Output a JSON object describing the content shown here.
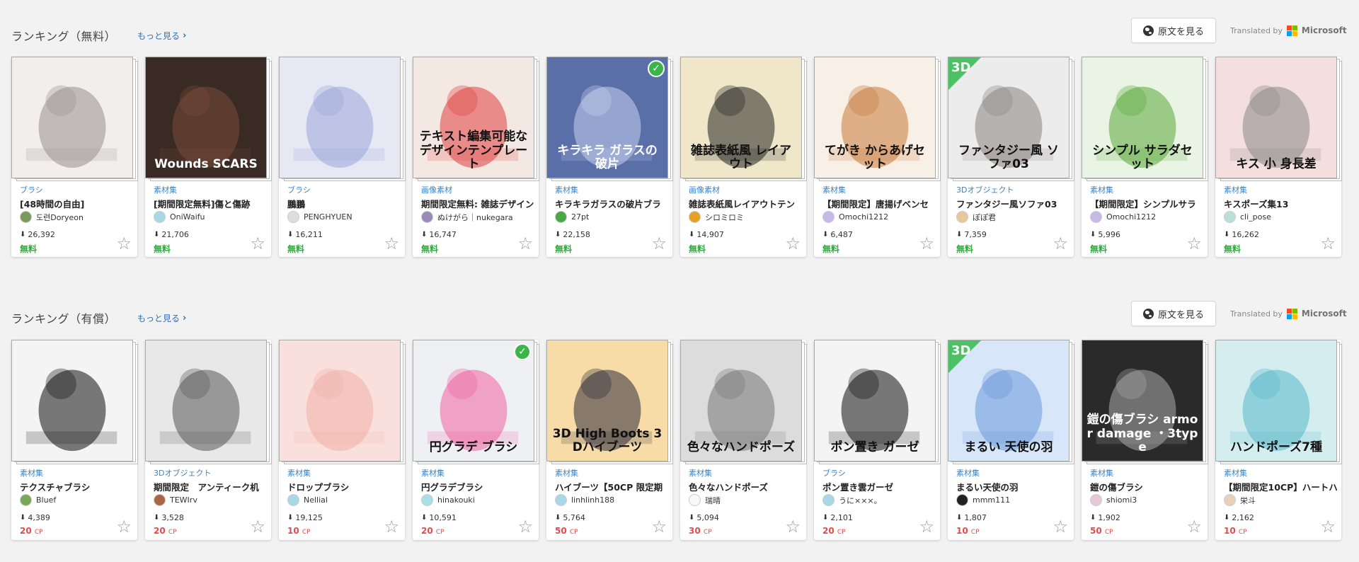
{
  "translate": {
    "button_label": "原文を見る",
    "translated_by": "Translated by",
    "provider": "Microsoft",
    "logo_colors": [
      "#f25022",
      "#7fba00",
      "#00a4ef",
      "#ffb900"
    ]
  },
  "sections": [
    {
      "title": "ランキング（無料）",
      "more": "もっと見る",
      "items": [
        {
          "category": "ブラシ",
          "title": "[48時間の自由]",
          "author": "도련Doryeon",
          "downloads": "26,392",
          "price": "無料",
          "checked": false,
          "bg": "#f2eeee",
          "fg": "#9a8f8f",
          "avatar": "#7a9a5a"
        },
        {
          "category": "素材集",
          "title": "[期間限定無料]傷と傷跡",
          "author": "OniWaifu",
          "downloads": "21,706",
          "price": "無料",
          "checked": false,
          "bg": "#3a2a24",
          "fg": "#7a4a3a",
          "avatar": "#a8d8e6",
          "thumb_text": "Wounds SCARS"
        },
        {
          "category": "ブラシ",
          "title": "鵬鵬",
          "author": "PENGHYUEN",
          "downloads": "16,211",
          "price": "無料",
          "checked": false,
          "bg": "#e6e8f4",
          "fg": "#9aa6d8",
          "avatar": "#ddd"
        },
        {
          "category": "画像素材",
          "title": "期間限定無料: 雑誌デザイン",
          "author": "ぬけがら｜nukegara",
          "downloads": "16,747",
          "price": "無料",
          "checked": false,
          "bg": "#f3e8e2",
          "fg": "#e04040",
          "avatar": "#9a8ab8",
          "thumb_text": "テキスト編集可能なデザインテンプレート"
        },
        {
          "category": "素材集",
          "title": "キラキラガラスの破片ブラ",
          "author": "27pt",
          "downloads": "22,158",
          "price": "無料",
          "checked": true,
          "bg": "#5a6ea8",
          "fg": "#c8d4f0",
          "avatar": "#48a848",
          "thumb_text": "キラキラ ガラスの破片"
        },
        {
          "category": "画像素材",
          "title": "雑誌表紙風レイアウトテン",
          "author": "シロミロミ",
          "downloads": "14,907",
          "price": "無料",
          "checked": false,
          "bg": "#f0e6c8",
          "fg": "#222",
          "avatar": "#e8a020",
          "thumb_text": "雑誌表紙風 レイアウト"
        },
        {
          "category": "素材集",
          "title": "【期間限定】唐揚げベンセ",
          "author": "Omochi1212",
          "downloads": "6,487",
          "price": "無料",
          "checked": false,
          "bg": "#f8f0e6",
          "fg": "#c87838",
          "avatar": "#c8b8e8",
          "thumb_text": "てがき からあげセット"
        },
        {
          "category": "3Dオブジェクト",
          "title": "ファンタジー風ソファ03",
          "author": "ぽぽ君",
          "downloads": "7,359",
          "price": "無料",
          "checked": false,
          "bg": "#ececec",
          "fg": "#8a8480",
          "avatar": "#e8c898",
          "thumb_text": "ファンタジー風 ソファ03",
          "badge": "3D"
        },
        {
          "category": "素材集",
          "title": "【期間限定】シンプルサラ",
          "author": "Omochi1212",
          "downloads": "5,996",
          "price": "無料",
          "checked": false,
          "bg": "#eaf4e4",
          "fg": "#58a838",
          "avatar": "#c8b8e8",
          "thumb_text": "シンプル サラダセット"
        },
        {
          "category": "素材集",
          "title": "キスポーズ集13",
          "author": "cli_pose",
          "downloads": "16,262",
          "price": "無料",
          "checked": false,
          "bg": "#f4dede",
          "fg": "#888",
          "avatar": "#b8e0d8",
          "thumb_text": "キス 小 身長差"
        }
      ]
    },
    {
      "title": "ランキング（有償）",
      "more": "もっと見る",
      "items": [
        {
          "category": "素材集",
          "title": "テクスチャブラシ",
          "author": "Bluef",
          "downloads": "4,389",
          "price": "20",
          "checked": false,
          "bg": "#f4f4f4",
          "fg": "#111",
          "avatar": "#78a858"
        },
        {
          "category": "3Dオブジェクト",
          "title": "期間限定　アンティーク机",
          "author": "TEWIrv",
          "downloads": "3,528",
          "price": "20",
          "checked": false,
          "bg": "#e8e8e8",
          "fg": "#555",
          "avatar": "#a86848"
        },
        {
          "category": "素材集",
          "title": "ドロップブラシ",
          "author": "Nellial",
          "downloads": "19,125",
          "price": "10",
          "checked": false,
          "bg": "#fae0dc",
          "fg": "#f0b0a8",
          "avatar": "#a8d8e6"
        },
        {
          "category": "素材集",
          "title": "円グラデブラシ",
          "author": "hinakouki",
          "downloads": "10,591",
          "price": "20",
          "checked": true,
          "bg": "#eef0f4",
          "fg": "#f060a0",
          "avatar": "#a8e0e8",
          "thumb_text": "円グラデ ブラシ"
        },
        {
          "category": "素材集",
          "title": "ハイブーツ【50CP 限定期",
          "author": "linhlinh188",
          "downloads": "5,764",
          "price": "50",
          "checked": false,
          "bg": "#f8dca8",
          "fg": "#2a2a38",
          "avatar": "#a8d8e6",
          "thumb_text": "3D High Boots 3Dハイブーツ"
        },
        {
          "category": "素材集",
          "title": "色々なハンドポーズ",
          "author": "瑞晴",
          "downloads": "5,094",
          "price": "30",
          "checked": false,
          "bg": "#dcdcdc",
          "fg": "#777",
          "avatar": "#f8f8f8",
          "thumb_text": "色々なハンドポーズ"
        },
        {
          "category": "ブラシ",
          "title": "ポン置き雲ガーゼ",
          "author": "うに×××。",
          "downloads": "2,101",
          "price": "20",
          "checked": false,
          "bg": "#f4f4f4",
          "fg": "#111",
          "avatar": "#a8d8e6",
          "thumb_text": "ポン置き ガーゼ"
        },
        {
          "category": "素材集",
          "title": "まるい天使の羽",
          "author": "mmm111",
          "downloads": "1,807",
          "price": "10",
          "checked": false,
          "bg": "#d8e6fa",
          "fg": "#6a98d8",
          "avatar": "#222",
          "thumb_text": "まるい 天使の羽",
          "badge": "3D"
        },
        {
          "category": "素材集",
          "title": "鎧の傷ブラシ",
          "author": "shiomi3",
          "downloads": "1,902",
          "price": "50",
          "checked": false,
          "bg": "#2a2a2a",
          "fg": "#aaa",
          "avatar": "#e8c8d8",
          "thumb_text": "鎧の傷ブラシ armor damage ・3type"
        },
        {
          "category": "素材集",
          "title": "【期間限定10CP】ハートハ",
          "author": "栄斗",
          "downloads": "2,162",
          "price": "10",
          "checked": false,
          "bg": "#d4eef0",
          "fg": "#58b8c8",
          "avatar": "#e8d0b8",
          "thumb_text": "ハンドポーズ7種"
        }
      ]
    }
  ],
  "price_unit": "CP"
}
